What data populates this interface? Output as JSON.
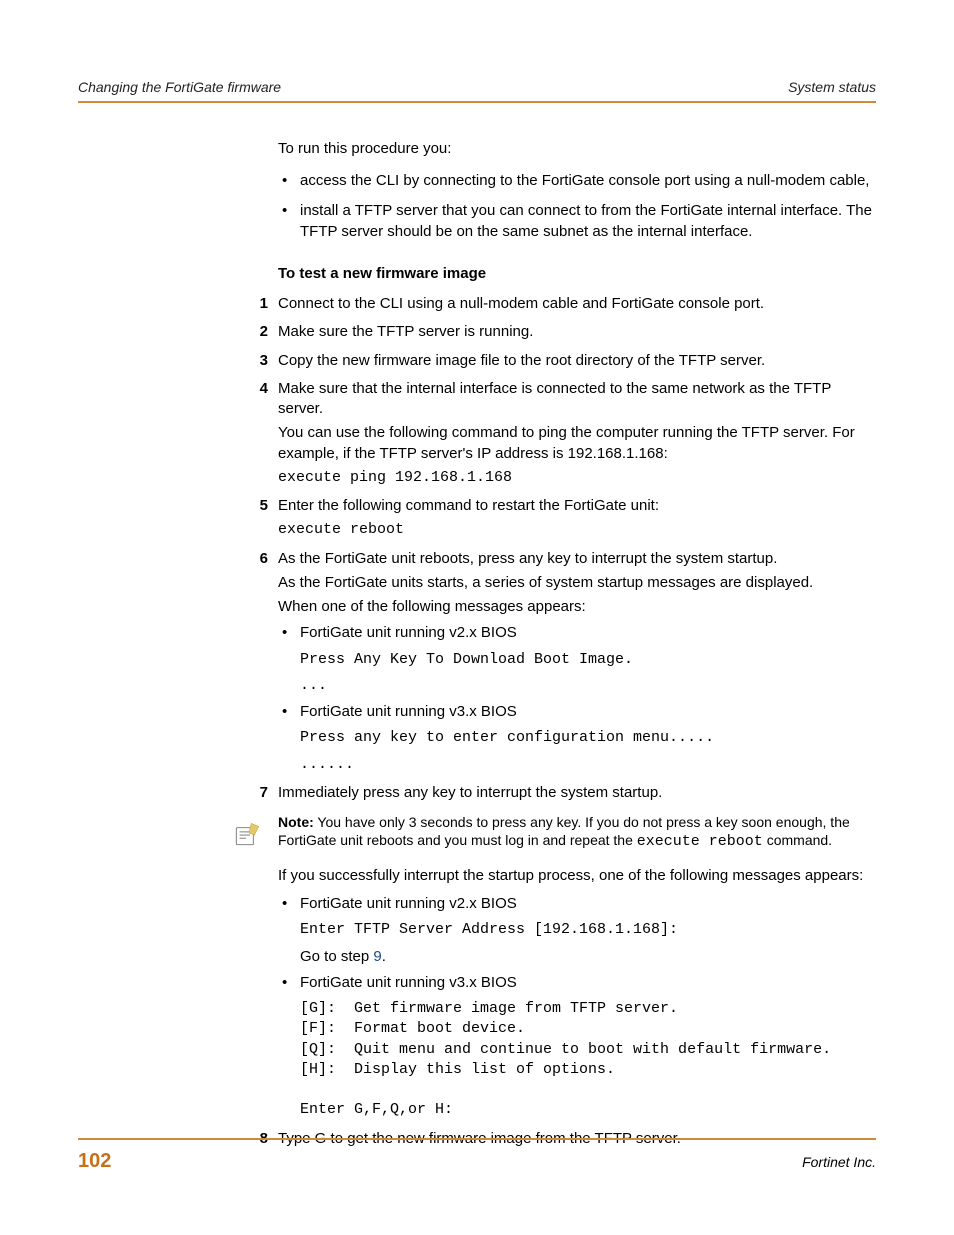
{
  "header": {
    "left": "Changing the FortiGate firmware",
    "right": "System status"
  },
  "intro": {
    "lead": "To run this procedure you:",
    "bullets": [
      "access the CLI by connecting to the FortiGate console port using a null-modem cable,",
      "install a TFTP server that you can connect to from the FortiGate internal interface. The TFTP server should be on the same subnet as the internal interface."
    ]
  },
  "section_title": "To test a new firmware image",
  "steps": {
    "1": "Connect to the CLI using a null-modem cable and FortiGate console port.",
    "2": "Make sure the TFTP server is running.",
    "3": "Copy the new firmware image file to the root directory of the TFTP server.",
    "4": {
      "p1": "Make sure that the internal interface is connected to the same network as the TFTP server.",
      "p2": "You can use the following command to ping the computer running the TFTP server. For example, if the TFTP server's IP address is 192.168.1.168:",
      "code": "execute ping 192.168.1.168"
    },
    "5": {
      "p1": "Enter the following command to restart the FortiGate unit:",
      "code": "execute reboot"
    },
    "6": {
      "p1": "As the FortiGate unit reboots, press any key to interrupt the system startup.",
      "p2": "As the FortiGate units starts, a series of system startup messages are displayed.",
      "p3": "When one of the following messages appears:",
      "b1_label": "FortiGate unit running v2.x BIOS",
      "b1_code": "Press Any Key To Download Boot Image.",
      "b1_dots": "...",
      "b2_label": "FortiGate unit running v3.x BIOS",
      "b2_code": "Press any key to enter configuration menu.....",
      "b2_dots": "......"
    },
    "7": "Immediately press any key to interrupt the system startup."
  },
  "note": {
    "bold": "Note:",
    "text1": " You have only 3 seconds to press any key. If you do not press a key soon enough, the FortiGate unit reboots and you must log in and repeat the ",
    "code": "execute reboot",
    "text2": " command."
  },
  "post_note": {
    "p1": "If you successfully interrupt the startup process, one of the following messages appears:",
    "b1_label": "FortiGate unit running v2.x BIOS",
    "b1_code": "Enter TFTP Server Address [192.168.1.168]:",
    "b1_goto_a": "Go to step ",
    "b1_goto_link": "9",
    "b1_goto_b": ".",
    "b2_label": "FortiGate unit running v3.x BIOS",
    "b2_block": "[G]:  Get firmware image from TFTP server.\n[F]:  Format boot device.\n[Q]:  Quit menu and continue to boot with default firmware.\n[H]:  Display this list of options.\n\nEnter G,F,Q,or H:"
  },
  "step8": "Type G to get the new firmware image from the TFTP server.",
  "footer": {
    "page": "102",
    "right": "Fortinet Inc."
  },
  "nums": {
    "n1": "1",
    "n2": "2",
    "n3": "3",
    "n4": "4",
    "n5": "5",
    "n6": "6",
    "n7": "7",
    "n8": "8"
  }
}
